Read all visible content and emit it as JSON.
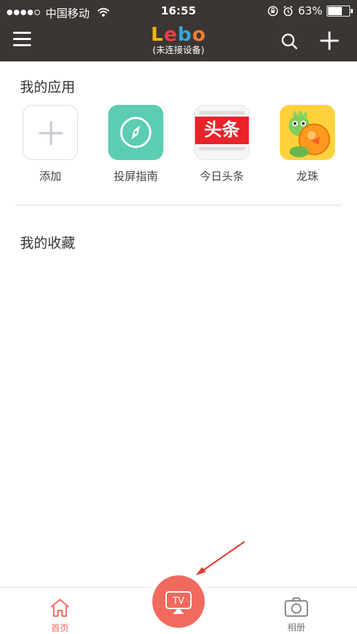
{
  "status_bar": {
    "carrier": "中国移动",
    "time": "16:55",
    "battery": "63%",
    "battery_level": 0.63
  },
  "header": {
    "logo_letters": [
      "L",
      "e",
      "b",
      "o"
    ],
    "subtitle": "(未连接设备)",
    "icons": [
      "menu-icon",
      "search-icon",
      "plus-icon"
    ],
    "colors": {
      "background": "#3b3634",
      "logo_l": "#f7b400",
      "logo_e": "#e83f3f",
      "logo_b": "#34a6d5",
      "logo_o": "#f07d2f"
    }
  },
  "my_apps": {
    "title": "我的应用",
    "items": [
      {
        "label": "添加",
        "icon": "add-icon"
      },
      {
        "label": "投屏指南",
        "icon": "compass-icon"
      },
      {
        "label": "今日头条",
        "icon": "toutiao-logo",
        "logo_text": "头条"
      },
      {
        "label": "龙珠",
        "icon": "dragon-mascot-icon"
      }
    ]
  },
  "favorites": {
    "title": "我的收藏"
  },
  "bottom_nav": {
    "home_label": "首页",
    "tv_label": "TV",
    "album_label": "相册",
    "accent": "#f26a5e"
  }
}
